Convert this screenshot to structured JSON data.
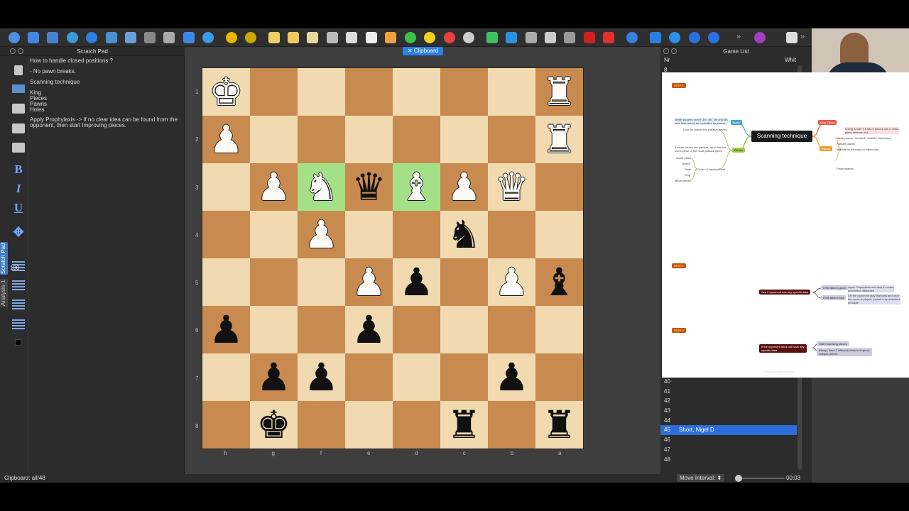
{
  "toolbar": {
    "more": "»"
  },
  "scratch": {
    "title": "Scratch Pad",
    "zoom": "100",
    "lines": [
      "How to handle closed positions ?",
      "- No pawn breaks.",
      "Scanning technique",
      "King\nPieces\nPawns\nHoles",
      "Apply Prophylaxis -> If no clear idea can be found from the\nopponent, then start Improving pieces."
    ],
    "tabs": [
      "Scratch Pad",
      "Analysis 1"
    ]
  },
  "clipboard_tab": "Clipboard",
  "board": {
    "ranks": [
      "1",
      "2",
      "3",
      "4",
      "5",
      "6",
      "7",
      "8"
    ],
    "files": [
      "h",
      "g",
      "f",
      "e",
      "d",
      "c",
      "b",
      "a"
    ],
    "squares": [
      [
        "wK",
        "",
        "",
        "",
        "",
        "",
        "",
        "wR"
      ],
      [
        "wP",
        "",
        "",
        "",
        "",
        "",
        "",
        "wR"
      ],
      [
        "",
        "wP",
        "wN*",
        "bQ",
        "wB*",
        "wP",
        "wQ",
        ""
      ],
      [
        "",
        "",
        "wP",
        "",
        "",
        "bN",
        "",
        ""
      ],
      [
        "",
        "",
        "",
        "wP",
        "bP",
        "",
        "wP",
        "bB"
      ],
      [
        "bP",
        "",
        "",
        "bP",
        "",
        "",
        "",
        ""
      ],
      [
        "",
        "bP",
        "bP",
        "",
        "",
        "",
        "bP",
        ""
      ],
      [
        "",
        "bK",
        "",
        "",
        "",
        "bR",
        "",
        "bR"
      ]
    ]
  },
  "gamelist": {
    "title": "Game List",
    "col_nr": "Nr",
    "col_white": "Whit",
    "first_row": "8",
    "rows": [
      {
        "nr": "40",
        "white": ""
      },
      {
        "nr": "41",
        "white": ""
      },
      {
        "nr": "42",
        "white": ""
      },
      {
        "nr": "43",
        "white": ""
      },
      {
        "nr": "44",
        "white": ""
      },
      {
        "nr": "45",
        "white": "Short, Nigel D",
        "selected": true
      },
      {
        "nr": "46",
        "white": ""
      },
      {
        "nr": "47",
        "white": ""
      },
      {
        "nr": "48",
        "white": ""
      }
    ]
  },
  "mindmap": {
    "step1": "STEP 1",
    "step2": "STEP 2",
    "step3": "STEP 3",
    "center": "Scanning technique",
    "holes": "Holes",
    "holes_note": "Weak squares on the 3rd, 4th, 5th and 6th\nrank that cannot be controlled by pawns.",
    "pieces": "Pieces",
    "pieces_notes": [
      "Look for Active and passive pieces",
      "If some pieces are passive, try to find the\nworst piece or the most passive piece.",
      "Worst piece",
      "Queen",
      "Rook",
      "King",
      "Minor pieces",
      "Order of Improvement"
    ],
    "king": "King Safety",
    "king_note": "A king is safe if it has 3 pawns and a minor\npiece defence of it.",
    "pawns": "Pawns",
    "pawn_notes": [
      "Weak pawns - isolated, doubled, backward",
      "Passed pawns",
      "Majority vs minority on either side",
      "Pawn islands"
    ],
    "s2_main": "See if opponent has any specific idea",
    "s2_a": "If the idea is good",
    "s2_a_note": "Apply Prophylaxis and stop it or take\npreventive measures",
    "s2_b": "If the idea is bad",
    "s2_b_note": "Let the opponent play that idea and once\nthe move is played, punish it by drawback\nprinciple",
    "s3_main": "If the opponent does not have any\nspecific idea",
    "s3_a": "Start improving pieces",
    "s3_b": "Always have 2 different ideas to improve\nmultiple pieces",
    "footer": "Prepared with Ambot AI"
  },
  "status": {
    "left": "Clipboard: all/48",
    "interval_label": "Move Interval:",
    "time": "00:03"
  }
}
